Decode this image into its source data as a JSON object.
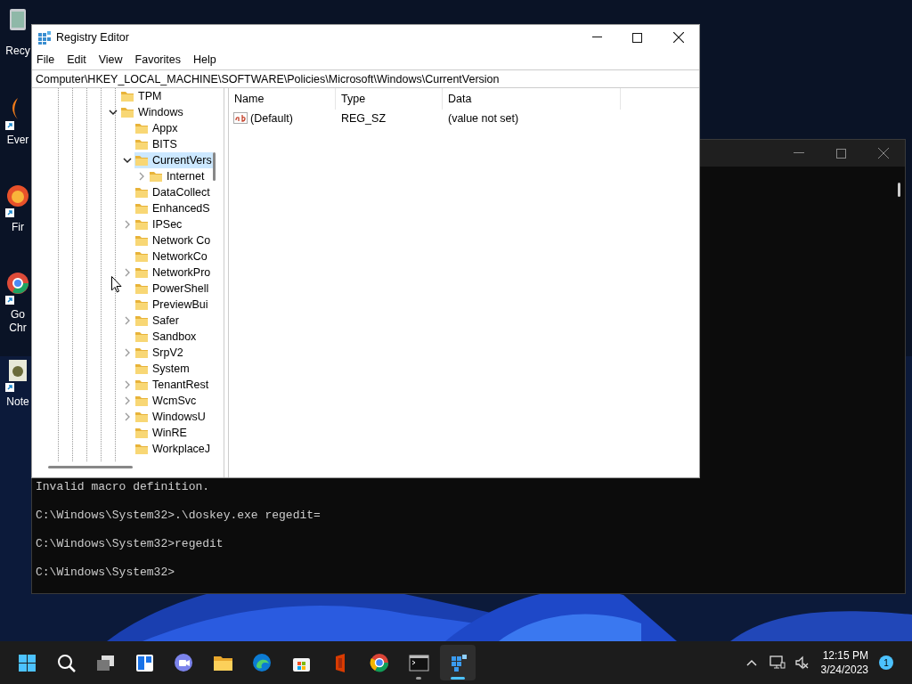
{
  "desktop_icons": [
    {
      "label": "Recy",
      "kind": "bin"
    },
    {
      "label": "Ever",
      "kind": "search"
    },
    {
      "label": "Fir",
      "kind": "firefox"
    },
    {
      "label": "Go Chr",
      "kind": "chrome"
    },
    {
      "label": "Note",
      "kind": "notepad"
    }
  ],
  "console": {
    "lines": [
      "Invalid macro definition.",
      "C:\\Windows\\System32>.\\doskey.exe regedit=",
      "C:\\Windows\\System32>regedit",
      "C:\\Windows\\System32>"
    ]
  },
  "regedit": {
    "title": "Registry Editor",
    "menu": [
      "File",
      "Edit",
      "View",
      "Favorites",
      "Help"
    ],
    "address": "Computer\\HKEY_LOCAL_MACHINE\\SOFTWARE\\Policies\\Microsoft\\Windows\\CurrentVersion",
    "tree": [
      {
        "label": "TPM",
        "selected": false
      },
      {
        "label": "Windows",
        "selected": false,
        "expandable": true,
        "expanded": true,
        "children": [
          {
            "label": "Appx",
            "selected": false
          },
          {
            "label": "BITS",
            "selected": false
          },
          {
            "label": "CurrentVers",
            "selected": true,
            "expandable": true,
            "expanded": true,
            "children": [
              {
                "label": "Internet",
                "selected": false,
                "expandable": true,
                "expanded": false
              }
            ]
          },
          {
            "label": "DataCollect",
            "selected": false
          },
          {
            "label": "EnhancedS",
            "selected": false
          },
          {
            "label": "IPSec",
            "selected": false,
            "expandable": true,
            "expanded": false
          },
          {
            "label": "Network Co",
            "selected": false
          },
          {
            "label": "NetworkCo",
            "selected": false
          },
          {
            "label": "NetworkPro",
            "selected": false,
            "expandable": true,
            "expanded": false
          },
          {
            "label": "PowerShell",
            "selected": false
          },
          {
            "label": "PreviewBui",
            "selected": false
          },
          {
            "label": "Safer",
            "selected": false,
            "expandable": true,
            "expanded": false
          },
          {
            "label": "Sandbox",
            "selected": false
          },
          {
            "label": "SrpV2",
            "selected": false,
            "expandable": true,
            "expanded": false
          },
          {
            "label": "System",
            "selected": false
          },
          {
            "label": "TenantRest",
            "selected": false,
            "expandable": true,
            "expanded": false
          },
          {
            "label": "WcmSvc",
            "selected": false,
            "expandable": true,
            "expanded": false
          },
          {
            "label": "WindowsU",
            "selected": false,
            "expandable": true,
            "expanded": false
          },
          {
            "label": "WinRE",
            "selected": false
          },
          {
            "label": "WorkplaceJ",
            "selected": false
          }
        ]
      }
    ],
    "columns": [
      "Name",
      "Type",
      "Data"
    ],
    "rows": [
      {
        "name": "(Default)",
        "type": "REG_SZ",
        "data": "(value not set)"
      }
    ]
  },
  "taskbar": {
    "apps": [
      {
        "kind": "start",
        "running": false,
        "active": false
      },
      {
        "kind": "search",
        "running": false,
        "active": false
      },
      {
        "kind": "taskview",
        "running": false,
        "active": false
      },
      {
        "kind": "widgets",
        "running": false,
        "active": false
      },
      {
        "kind": "chat",
        "running": false,
        "active": false
      },
      {
        "kind": "explorer",
        "running": false,
        "active": false
      },
      {
        "kind": "edge",
        "running": false,
        "active": false
      },
      {
        "kind": "store",
        "running": false,
        "active": false
      },
      {
        "kind": "office",
        "running": false,
        "active": false
      },
      {
        "kind": "chrome",
        "running": false,
        "active": false
      },
      {
        "kind": "terminal",
        "running": true,
        "active": false
      },
      {
        "kind": "regedit",
        "running": true,
        "active": true
      }
    ],
    "time": "12:15 PM",
    "date": "3/24/2023",
    "notifications": "1"
  }
}
